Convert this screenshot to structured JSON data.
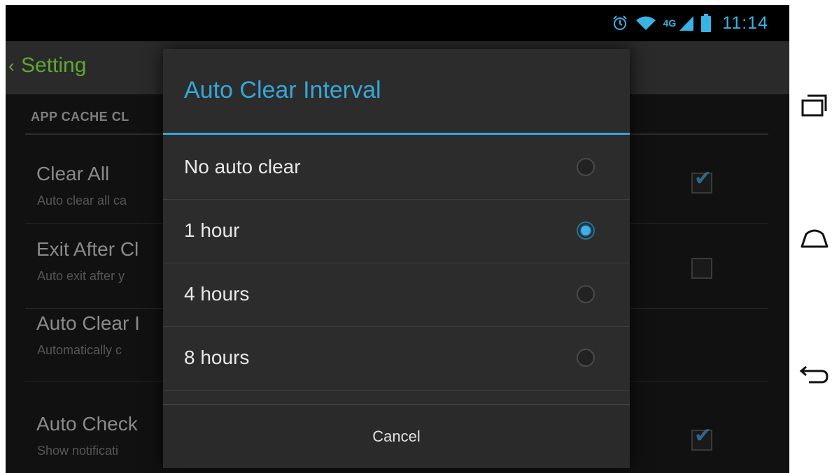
{
  "status_bar": {
    "network_label": "4G",
    "time": "11:14",
    "icons": [
      "alarm-icon",
      "wifi-icon",
      "signal-icon",
      "battery-icon"
    ]
  },
  "action_bar": {
    "back_caret": "‹",
    "title": "Setting"
  },
  "settings": {
    "section_header": "APP CACHE CL",
    "items": [
      {
        "title": "Clear All",
        "summary": "Auto clear all ca",
        "checked": true
      },
      {
        "title": "Exit After Cl",
        "summary": "Auto exit after y",
        "checked": false
      },
      {
        "title": "Auto Clear I",
        "summary": "Automatically c",
        "checked": null
      },
      {
        "title": "Auto Check",
        "summary": "Show notificati",
        "checked": true
      }
    ]
  },
  "dialog": {
    "title": "Auto Clear Interval",
    "options": [
      {
        "label": "No auto clear",
        "selected": false
      },
      {
        "label": "1 hour",
        "selected": true
      },
      {
        "label": "4 hours",
        "selected": false
      },
      {
        "label": "8 hours",
        "selected": false
      }
    ],
    "cancel_label": "Cancel"
  },
  "nav_bar": {
    "buttons": [
      "recent-apps-icon",
      "home-icon",
      "back-icon"
    ]
  },
  "colors": {
    "accent": "#35a6dc",
    "action_title": "#5fa833",
    "dialog_bg": "#2c2c2c",
    "screen_bg": "#111111"
  }
}
